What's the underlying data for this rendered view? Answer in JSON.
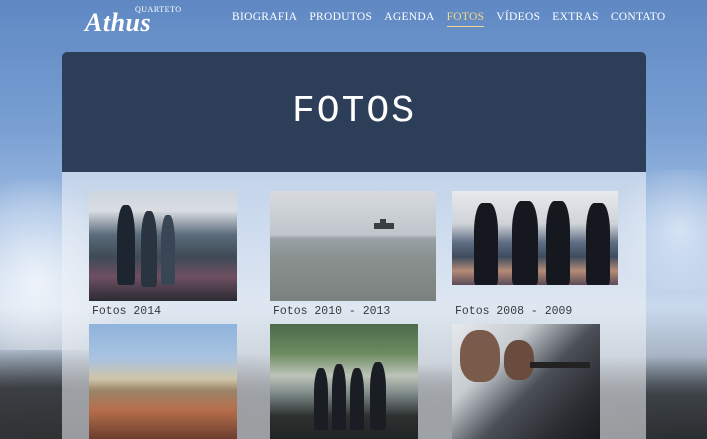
{
  "brand": {
    "name": "Athus",
    "sub": "QUARTETO"
  },
  "nav": {
    "items": [
      {
        "label": "BIOGRAFIA"
      },
      {
        "label": "PRODUTOS"
      },
      {
        "label": "AGENDA"
      },
      {
        "label": "FOTOS",
        "active": true
      },
      {
        "label": "VÍDEOS"
      },
      {
        "label": "EXTRAS"
      },
      {
        "label": "CONTATO"
      }
    ],
    "active_color": "#f4d98a"
  },
  "page": {
    "title": "FOTOS"
  },
  "gallery": [
    {
      "caption": "Fotos 2014",
      "icon": "photo-thumbnail"
    },
    {
      "caption": "Fotos 2010 - 2013",
      "icon": "photo-thumbnail"
    },
    {
      "caption": "Fotos 2008 - 2009",
      "icon": "photo-thumbnail"
    },
    {
      "caption": "",
      "icon": "photo-thumbnail"
    },
    {
      "caption": "",
      "icon": "photo-thumbnail"
    },
    {
      "caption": "",
      "icon": "photo-thumbnail"
    }
  ],
  "colors": {
    "header_bg": "#2d3e58",
    "text": "#ffffff"
  }
}
